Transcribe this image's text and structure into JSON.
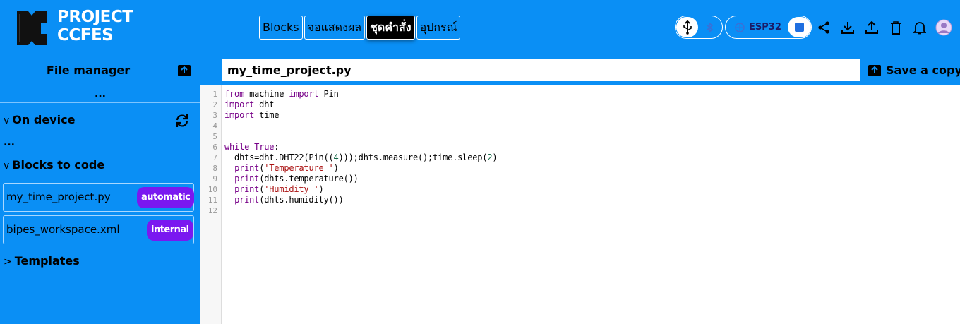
{
  "brand": {
    "line1": "PROJECT",
    "line2": "CCFES"
  },
  "tabs": [
    {
      "label": "Blocks",
      "active": false
    },
    {
      "label": "จอแสดงผล",
      "active": false
    },
    {
      "label": "ชุดคำสั่ง",
      "active": true
    },
    {
      "label": "อุปกรณ์",
      "active": false
    }
  ],
  "device": {
    "label": "ESP32"
  },
  "colors": {
    "header": "#0a8ff5",
    "badge": "#7a18f0",
    "keyword": "#770088",
    "string": "#aa1111",
    "number": "#116644"
  },
  "header_icons": [
    "usb-icon",
    "bluetooth-icon",
    "wifi-icon",
    "stop-icon",
    "share-icon",
    "download-icon",
    "upload-icon",
    "trash-icon",
    "bell-icon",
    "user-avatar-icon"
  ],
  "sidebar": {
    "title": "File manager",
    "path": "...",
    "on_device": {
      "label": "On device",
      "chevron": "v",
      "content": "..."
    },
    "blocks_to_code": {
      "label": "Blocks to code",
      "chevron": "v",
      "files": [
        {
          "name": "my_time_project.py",
          "badge": "automatic"
        },
        {
          "name": "bipes_workspace.xml",
          "badge": "internal"
        }
      ]
    },
    "templates": {
      "label": "Templates",
      "chevron": ">"
    }
  },
  "editor": {
    "filename": "my_time_project.py",
    "save_copy_label": "Save a copy",
    "line_numbers": [
      "1",
      "2",
      "3",
      "4",
      "5",
      "6",
      "7",
      "8",
      "9",
      "10",
      "11",
      "12"
    ],
    "lines": [
      "from machine import Pin",
      "import dht",
      "import time",
      "",
      "",
      "while True:",
      "  dhts=dht.DHT22(Pin((4)));dhts.measure();time.sleep(2)",
      "  print('Temperature ')",
      "  print(dhts.temperature())",
      "  print('Humidity ')",
      "  print(dhts.humidity())",
      ""
    ]
  }
}
